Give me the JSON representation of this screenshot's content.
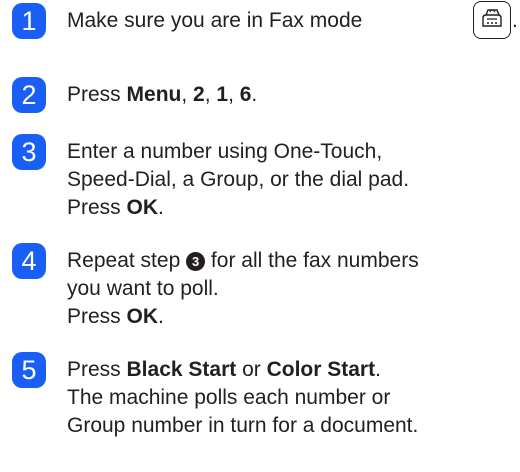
{
  "steps": [
    {
      "number": "1",
      "text_before_icon": "Make sure you are in Fax mode",
      "icon": "fax-mode-key-icon",
      "text_after_icon": "."
    },
    {
      "number": "2",
      "parts": [
        "Press ",
        "Menu",
        ", ",
        "2",
        ", ",
        "1",
        ", ",
        "6",
        "."
      ]
    },
    {
      "number": "3",
      "lines": [
        "Enter a number using One-Touch,",
        "Speed-Dial, a Group, or the dial pad."
      ],
      "press": "Press ",
      "ok": "OK",
      "period": "."
    },
    {
      "number": "4",
      "line1_before": "Repeat step ",
      "step_ref": "3",
      "line1_after": " for all the fax numbers",
      "line2": "you want to poll.",
      "press": "Press ",
      "ok": "OK",
      "period": "."
    },
    {
      "number": "5",
      "press": "Press ",
      "black_start": "Black Start",
      "or": " or ",
      "color_start": "Color Start",
      "period": ".",
      "lines": [
        "The machine polls each number or",
        "Group number in turn for a document."
      ]
    }
  ],
  "colors": {
    "badge": "#1a5ff5",
    "text": "#231f20"
  }
}
